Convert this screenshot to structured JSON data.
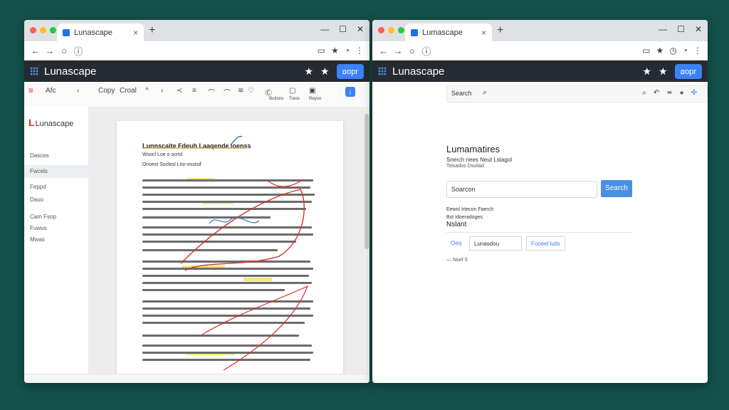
{
  "left_window": {
    "tab_title": "Lunascape",
    "tab_close": "×",
    "new_tab": "+",
    "window_controls": [
      "—",
      "☐",
      "✕"
    ],
    "nav": {
      "back": "←",
      "forward": "→",
      "reload": "○",
      "secure": "ⓘ"
    },
    "addr_icons": [
      "▭",
      "★",
      "◔",
      "⋮"
    ],
    "app": {
      "title": "Lunascape",
      "button_label": "ꞛopr"
    },
    "toolbar_items": [
      "≡",
      "Afc",
      "‹",
      "Copy",
      "Croal",
      "^",
      "‹",
      "≺",
      "≡",
      "⌒",
      "⌒",
      "≋",
      "♡",
      "Ⓒ",
      "▢",
      "▣"
    ],
    "toolbar_sub": [
      "Buttons",
      "Tress",
      "Reyoo"
    ],
    "sidebar": {
      "brand": "Lunascape",
      "items": [
        "Dasces",
        "Fwcels",
        "Feppd",
        "Dauo",
        "Cam Fsop",
        "Fuwus",
        "Mwas"
      ]
    },
    "document": {
      "title": "Lunnscaite Fdeuh Laaqende loenss",
      "line1": "Wsocl Loe o ocrtd",
      "line2": "Dnoest Soclesl Ltor-esstsif"
    }
  },
  "right_window": {
    "tab_title": "Lumascape",
    "tab_close": "×",
    "new_tab": "+",
    "window_controls": [
      "—",
      "☐",
      "✕"
    ],
    "nav": {
      "back": "←",
      "forward": "→",
      "reload": "○",
      "secure": "ⓘ"
    },
    "addr_icons": [
      "▭",
      "★",
      "◷",
      "◔",
      "⋮"
    ],
    "app": {
      "title": "Lunascape",
      "button_label": "ꞛopr"
    },
    "search_strip": {
      "label": "Search",
      "icons": [
        "⌕",
        "↶",
        "≖",
        "⚹",
        "✣"
      ]
    },
    "content": {
      "title": "Lumamatires",
      "subtitle1": "Snerch nees Neut Lstagol",
      "subtitle2": "Tolsados Dsoilad",
      "input_placeholder": "Soarcon",
      "search_button": "Search",
      "small1": "Eewol Irtecon Faerch",
      "small2": "Bst Idoeradoges",
      "heading": "Nslant",
      "chip1": "Oeq",
      "chip2": "Lunasdou",
      "chip3": "Fooeel lutls",
      "note": "—   Nsef S"
    }
  },
  "colors": {
    "desktop": "#14504a",
    "appbar": "#262b33",
    "accent": "#3b82f6"
  }
}
